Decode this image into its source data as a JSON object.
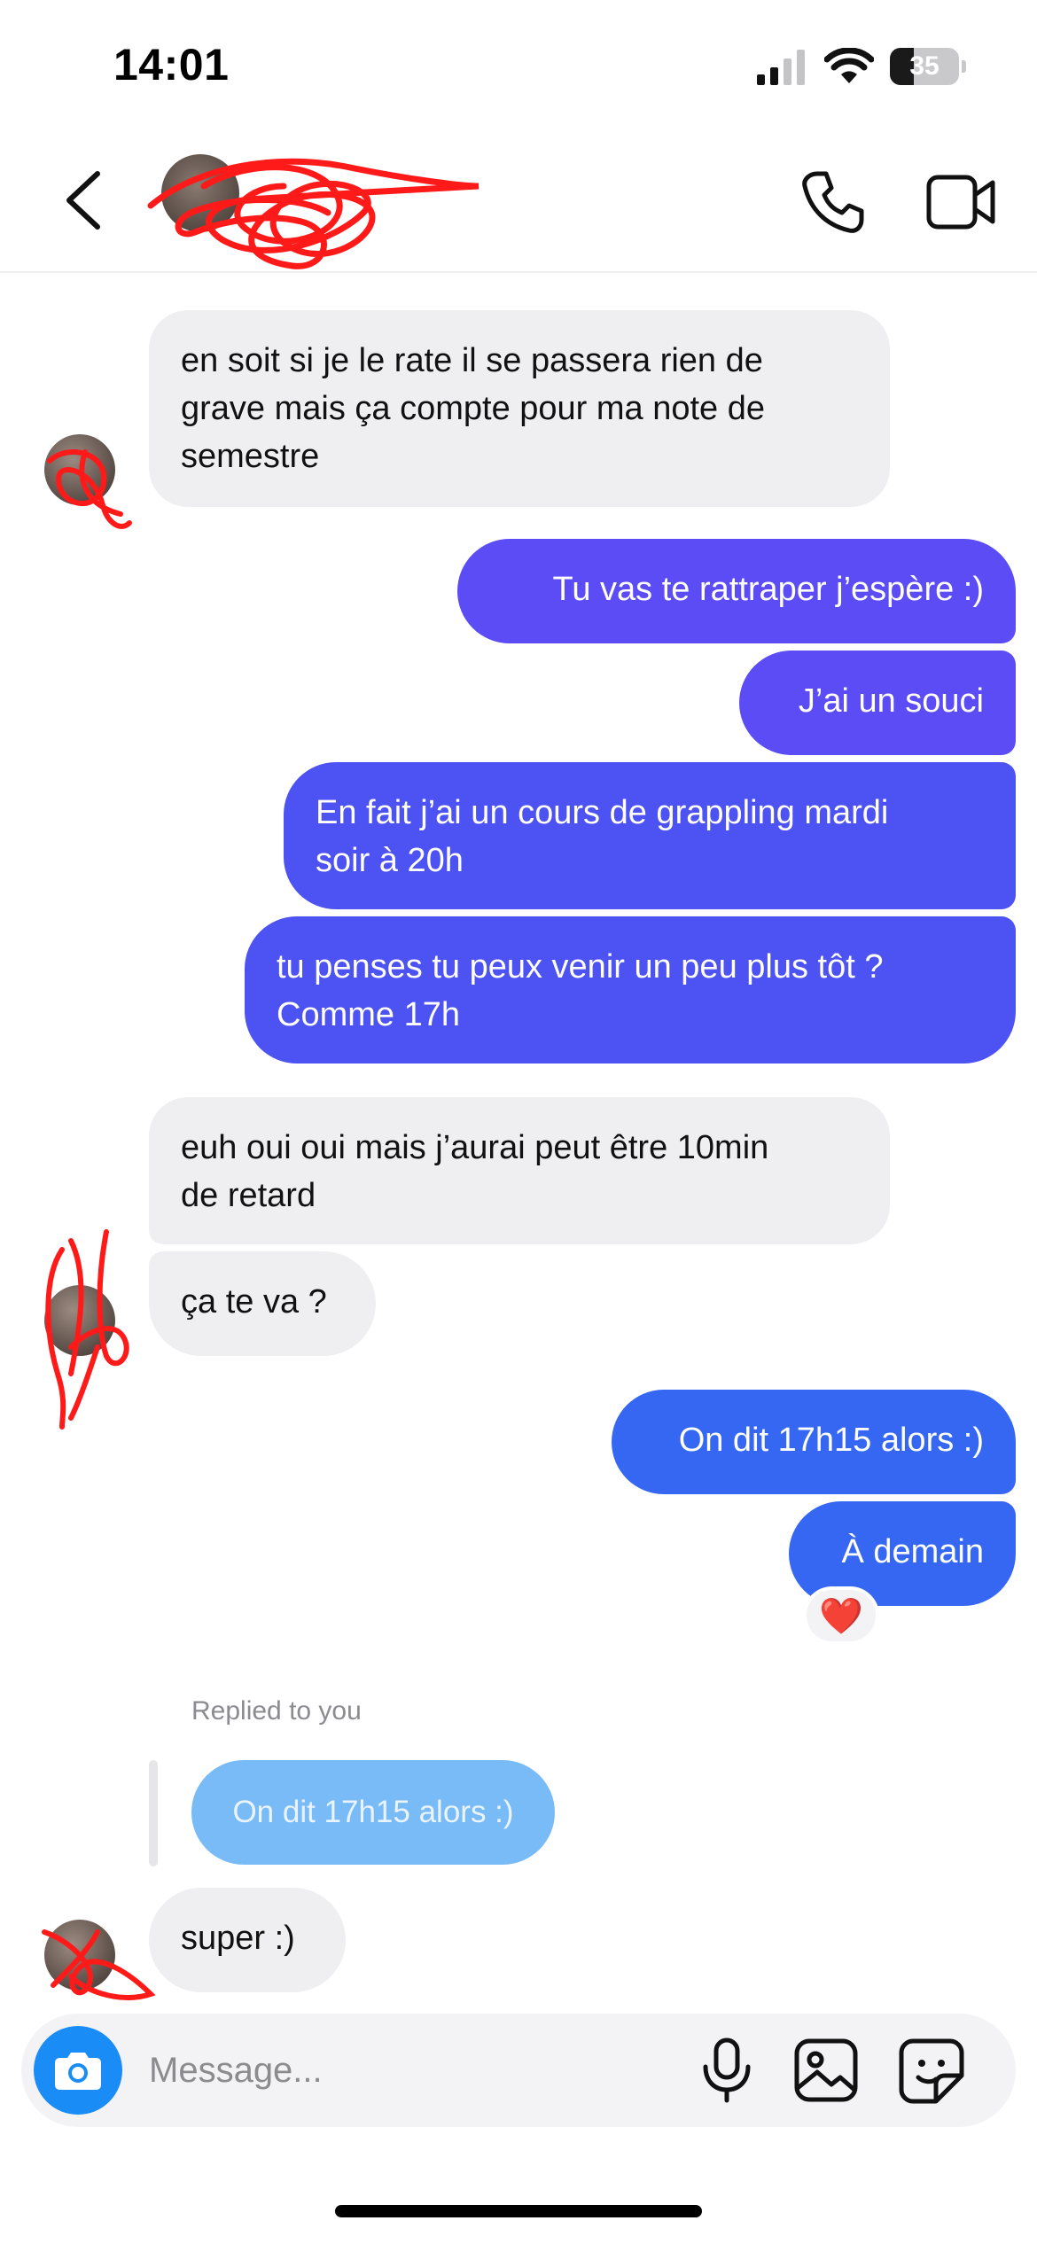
{
  "status_bar": {
    "time": "14:01",
    "battery": "35",
    "battery_level": 0.35,
    "signal_bars": 2
  },
  "header": {
    "icons": {
      "back": "chevron-left-icon",
      "call": "phone-icon",
      "video": "video-camera-icon"
    }
  },
  "messages": [
    {
      "direction": "incoming",
      "lines": [
        "en soit si je le rate il se passera rien de",
        "grave mais ça compte pour ma note de",
        "semestre"
      ]
    },
    {
      "direction": "outgoing",
      "lines": [
        "Tu vas te rattraper j’espère :)"
      ]
    },
    {
      "direction": "outgoing",
      "lines": [
        "J’ai un souci"
      ]
    },
    {
      "direction": "outgoing",
      "lines": [
        "En fait j’ai un cours de grappling mardi",
        "soir à 20h"
      ]
    },
    {
      "direction": "outgoing",
      "lines": [
        "tu penses tu peux venir un peu plus tôt ?",
        "Comme 17h"
      ]
    },
    {
      "direction": "incoming",
      "lines": [
        "euh oui oui mais j’aurai peut être 10min",
        "de retard"
      ]
    },
    {
      "direction": "incoming",
      "lines": [
        "ça te va ?"
      ]
    },
    {
      "direction": "outgoing",
      "lines": [
        "On dit 17h15 alors :)"
      ]
    },
    {
      "direction": "outgoing",
      "lines": [
        "À demain"
      ],
      "reaction": "❤️"
    },
    {
      "direction": "incoming",
      "lines": [
        "super :)"
      ]
    }
  ],
  "reply": {
    "label": "Replied to you",
    "quoted_text": "On dit 17h15 alors :)"
  },
  "composer": {
    "placeholder": "Message...",
    "icons": {
      "camera": "camera-icon",
      "mic": "microphone-icon",
      "gallery": "image-icon",
      "sticker": "sticker-icon"
    }
  },
  "colors": {
    "incoming_bubble": "#efeff1",
    "outgoing_purple": "#5b4cf5",
    "outgoing_indigo": "#4d52f2",
    "outgoing_blue": "#3567f2",
    "reply_bubble": "#78bbf7",
    "camera_button": "#1a8cf5",
    "redaction": "#ff1a1a"
  }
}
